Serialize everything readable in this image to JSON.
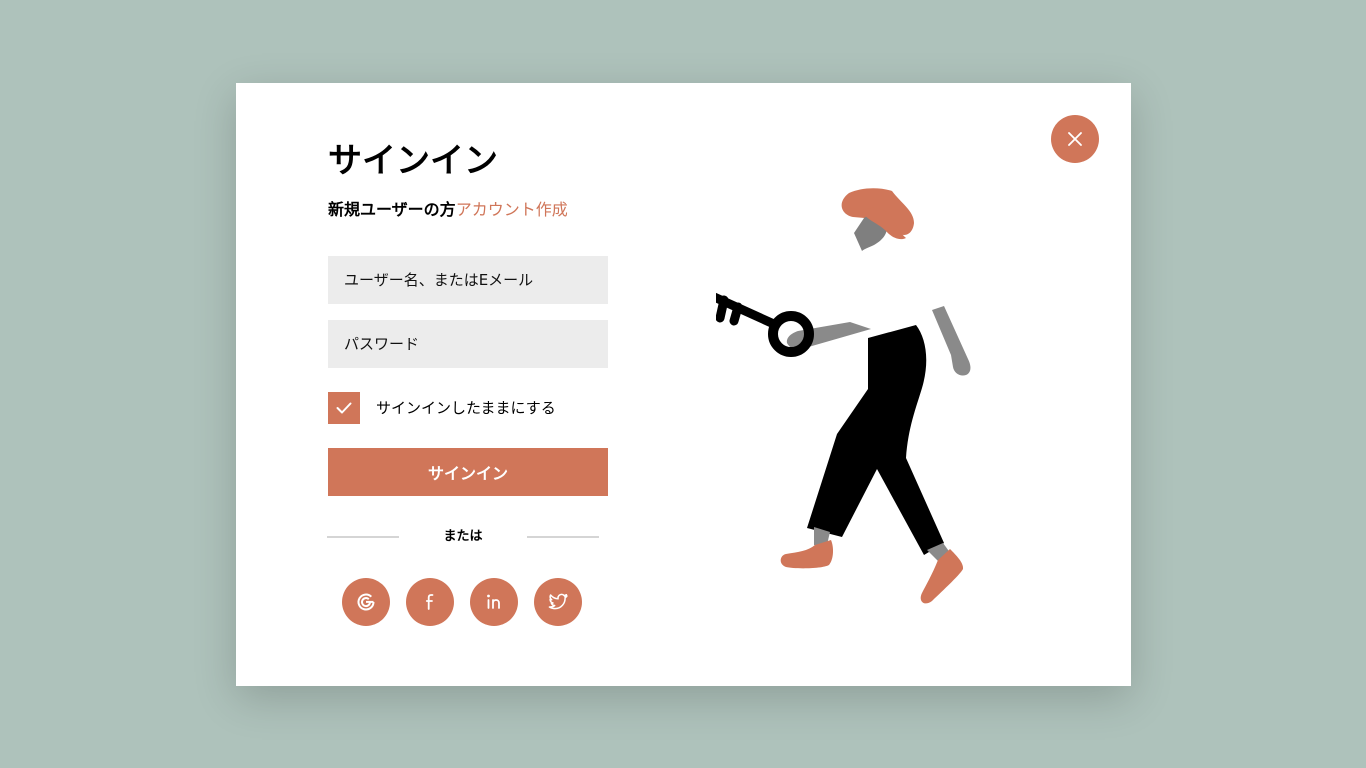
{
  "modal": {
    "title": "サインイン",
    "subtitle_prefix": "新規ユーザーの方",
    "create_account_link": "アカウント作成",
    "username_placeholder": "ユーザー名、またはEメール",
    "password_placeholder": "パスワード",
    "remember_me_label": "サインインしたままにする",
    "remember_me_checked": true,
    "signin_button_label": "サインイン",
    "divider_text": "または",
    "social_buttons": [
      {
        "icon": "google-icon"
      },
      {
        "icon": "facebook-icon"
      },
      {
        "icon": "linkedin-icon"
      },
      {
        "icon": "twitter-icon"
      }
    ],
    "close_icon": "close-icon"
  },
  "colors": {
    "background": "#aec2bb",
    "accent": "#d07659",
    "input_bg": "#ececec",
    "card": "#ffffff",
    "skin": "#8a8a8a"
  }
}
